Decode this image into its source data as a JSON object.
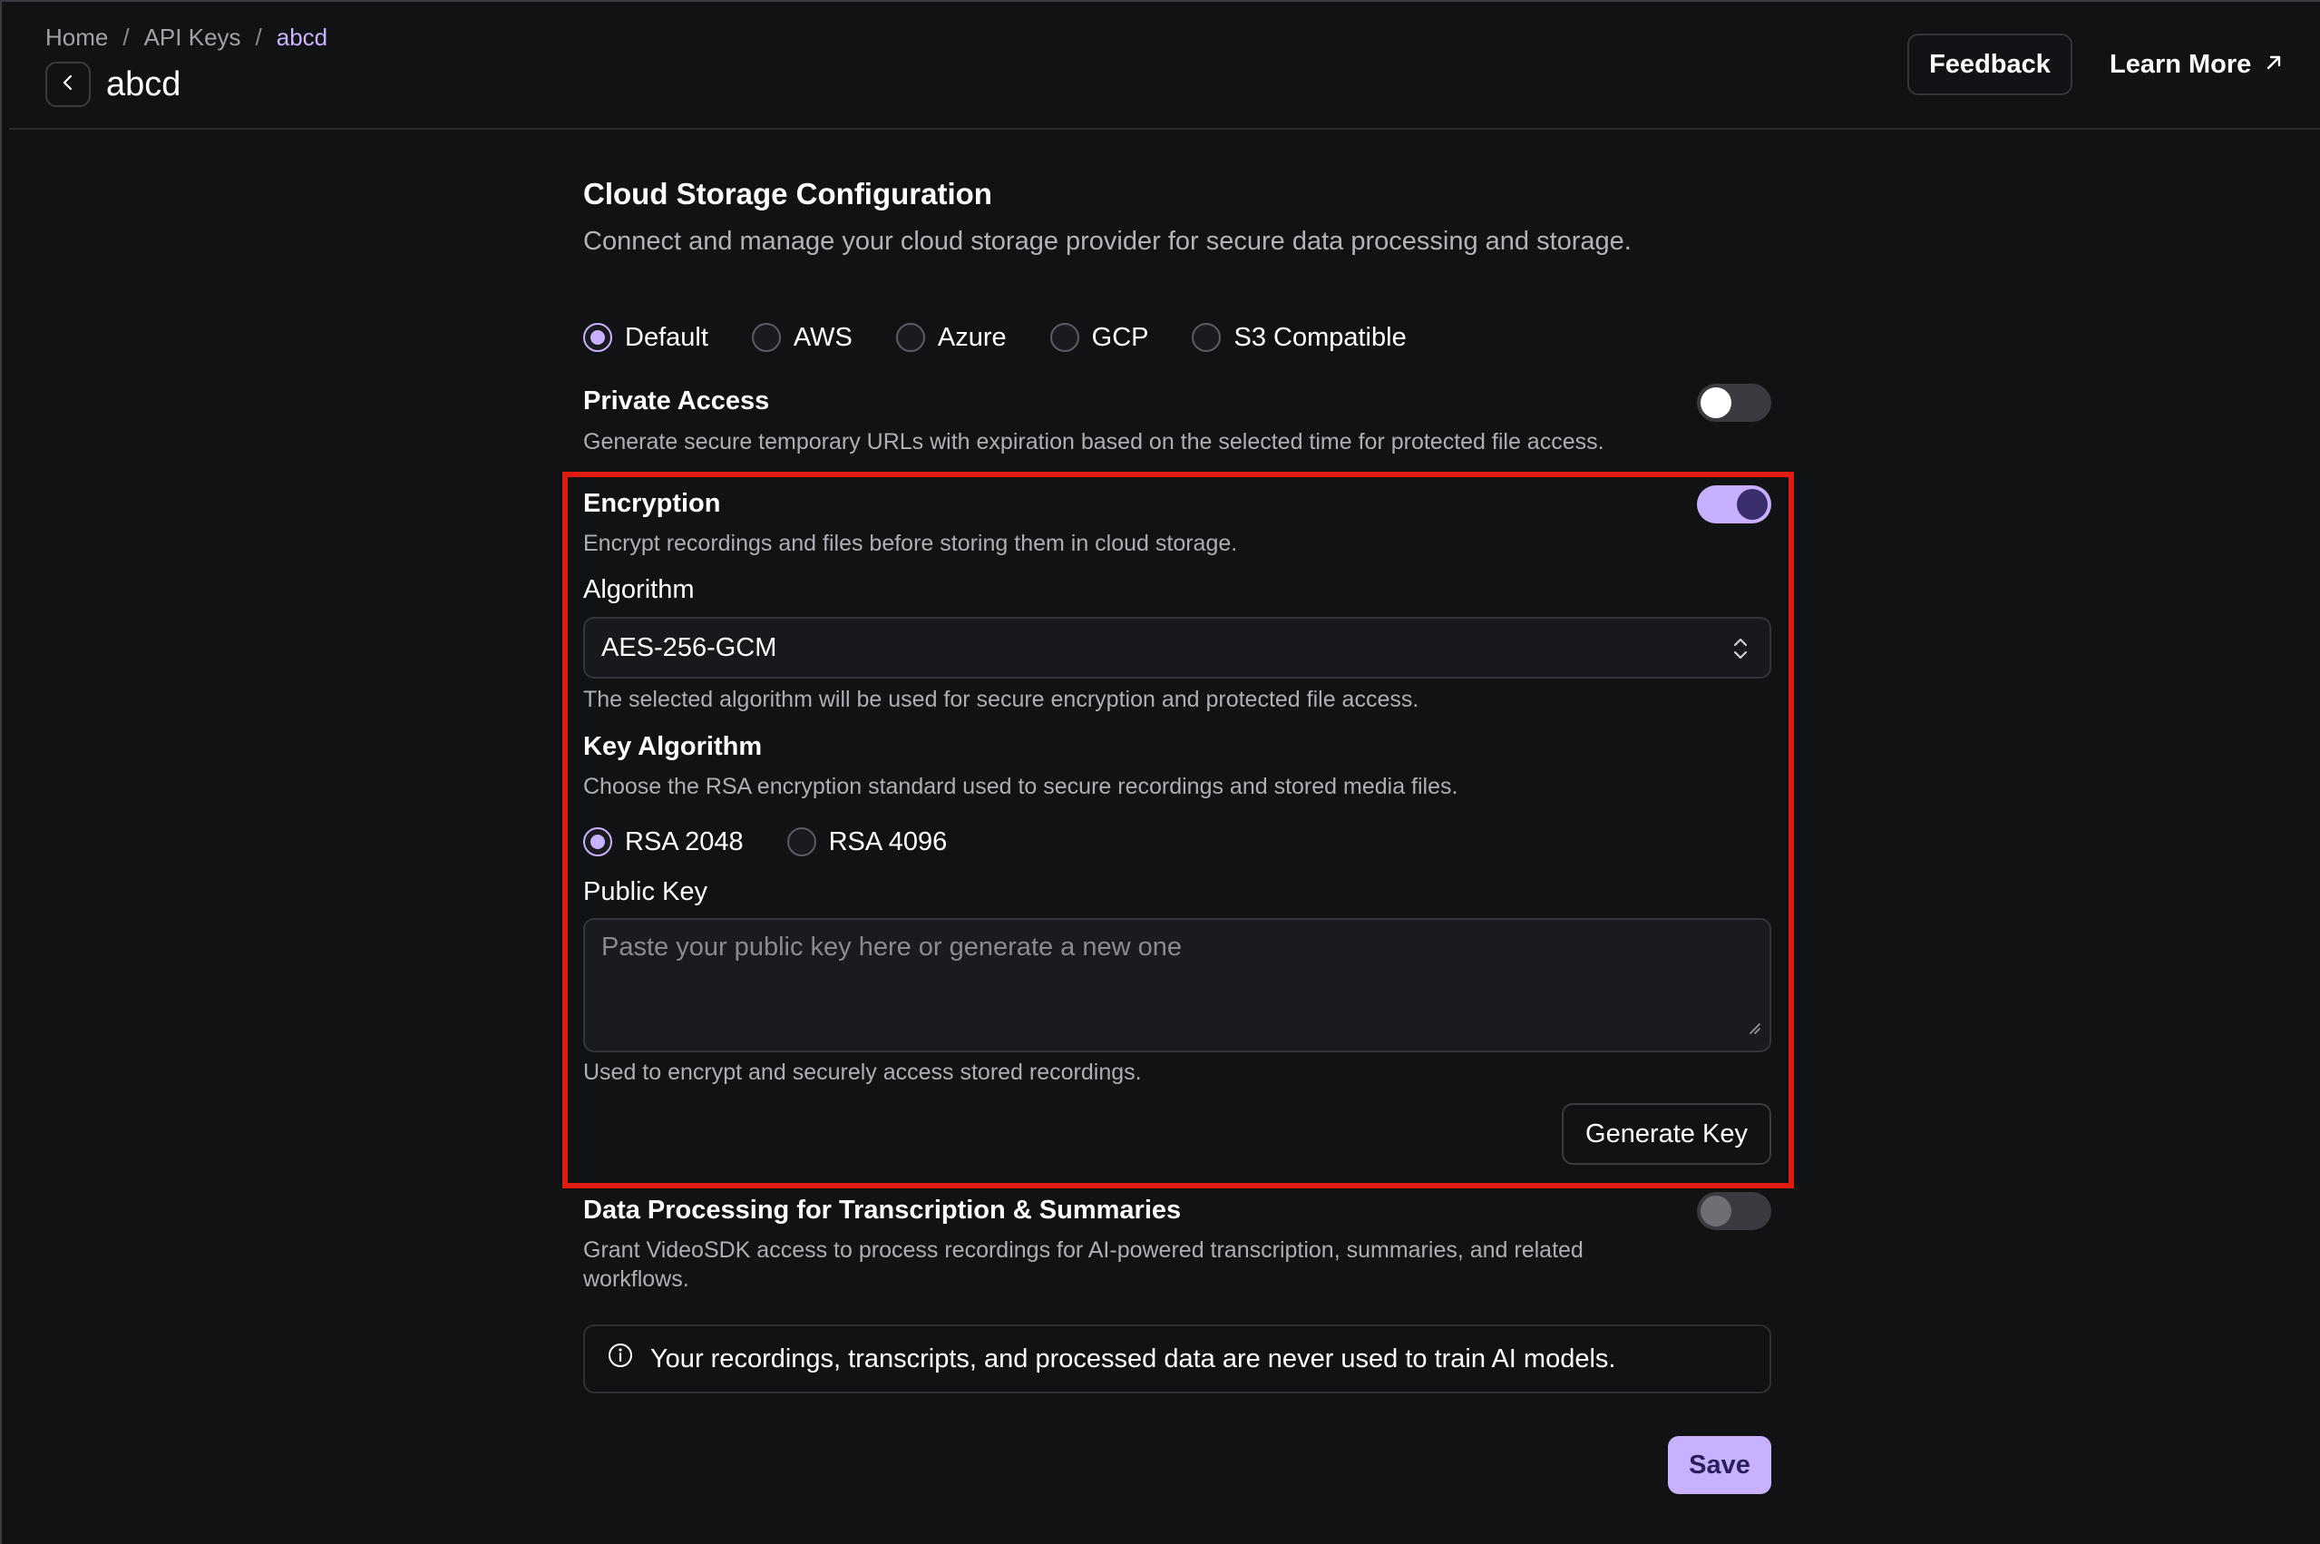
{
  "breadcrumb": {
    "items": [
      "Home",
      "API Keys",
      "abcd"
    ],
    "separator": "/"
  },
  "page": {
    "title": "abcd"
  },
  "header": {
    "feedback_label": "Feedback",
    "learn_more_label": "Learn More"
  },
  "cloud_storage": {
    "title": "Cloud Storage Configuration",
    "description": "Connect and manage your cloud storage provider for secure data processing and storage.",
    "providers": [
      {
        "label": "Default",
        "checked": true
      },
      {
        "label": "AWS",
        "checked": false
      },
      {
        "label": "Azure",
        "checked": false
      },
      {
        "label": "GCP",
        "checked": false
      },
      {
        "label": "S3 Compatible",
        "checked": false
      }
    ]
  },
  "private_access": {
    "title": "Private Access",
    "description": "Generate secure temporary URLs with expiration based on the selected time for protected file access.",
    "enabled": false
  },
  "encryption": {
    "title": "Encryption",
    "description": "Encrypt recordings and files before storing them in cloud storage.",
    "enabled": true,
    "algorithm_label": "Algorithm",
    "algorithm_value": "AES-256-GCM",
    "algorithm_help": "The selected algorithm will be used for secure encryption and protected file access.",
    "key_algorithm_title": "Key Algorithm",
    "key_algorithm_description": "Choose the RSA encryption standard used to secure recordings and stored media files.",
    "key_options": [
      {
        "label": "RSA 2048",
        "checked": true
      },
      {
        "label": "RSA 4096",
        "checked": false
      }
    ],
    "public_key_label": "Public Key",
    "public_key_placeholder": "Paste your public key here or generate a new one",
    "public_key_help": "Used to encrypt and securely access stored recordings.",
    "generate_label": "Generate Key"
  },
  "data_processing": {
    "title": "Data Processing for Transcription & Summaries",
    "description_line1": "Grant VideoSDK access to process recordings for AI-powered transcription, summaries, and related",
    "description_line2": "workflows.",
    "enabled": false
  },
  "notice": {
    "text": "Your recordings, transcripts, and processed data are never used to train AI models."
  },
  "save_label": "Save",
  "colors": {
    "background": "#111214",
    "accent": "#c8b2ff",
    "highlight_border": "#e01b10",
    "breadcrumb_current": "#c9b4ff"
  }
}
